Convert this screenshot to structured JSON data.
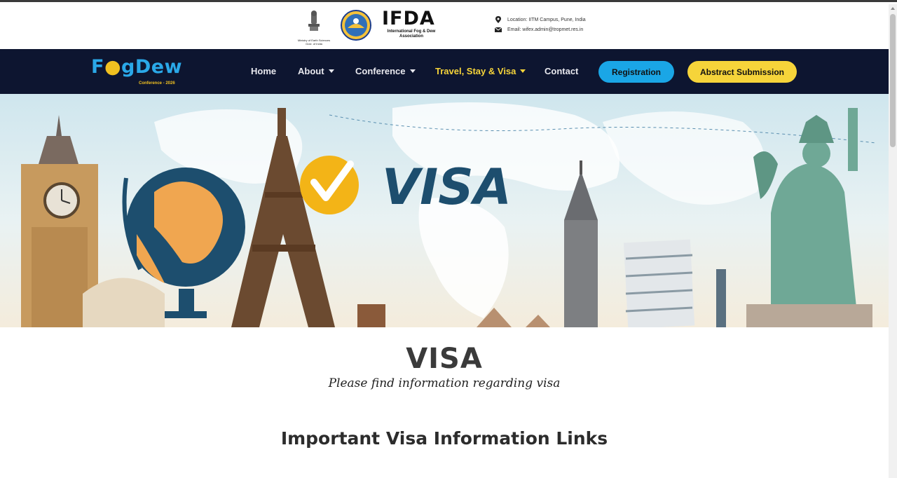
{
  "topbar": {
    "emblem_caption": "Ministry of Earth Sciences Govt. of India",
    "org_title": "IFDA",
    "org_subtitle": "International Fog & Dew Association",
    "location": "Location: IITM Campus, Pune, India",
    "email": "Email: wifex.admin@tropmet.res.in",
    "location_icon": "map-pin-icon",
    "email_icon": "envelope-icon"
  },
  "nav": {
    "logo_text_a": "F",
    "logo_text_b": "gDew",
    "logo_sub": "Conference - 2026",
    "items": [
      {
        "label": "Home",
        "has_caret": false,
        "active": false
      },
      {
        "label": "About",
        "has_caret": true,
        "active": false
      },
      {
        "label": "Conference",
        "has_caret": true,
        "active": false
      },
      {
        "label": "Travel, Stay & Visa",
        "has_caret": true,
        "active": true
      },
      {
        "label": "Contact",
        "has_caret": false,
        "active": false
      }
    ],
    "registration_label": "Registration",
    "abstract_label": "Abstract Submission"
  },
  "hero": {
    "banner_text": "VISA"
  },
  "content": {
    "title": "VISA",
    "subtitle": "Please find information regarding visa",
    "section_title": "Important Visa Information Links"
  },
  "colors": {
    "nav_bg": "#0d1530",
    "accent_yellow": "#f6d43a",
    "accent_blue": "#1aa6e6",
    "visa_text": "#1d4e6e"
  }
}
